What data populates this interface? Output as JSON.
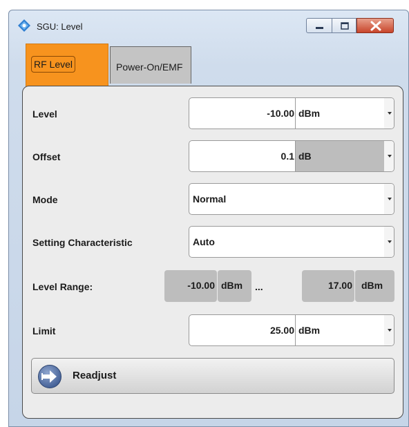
{
  "window": {
    "title": "SGU: Level",
    "controls": {
      "minimize": "minimize",
      "maximize": "maximize",
      "close": "close"
    }
  },
  "tabs": [
    {
      "label": "RF Level",
      "active": true
    },
    {
      "label": "Power-On/EMF",
      "active": false
    }
  ],
  "form": {
    "level": {
      "label": "Level",
      "value": "-10.00",
      "unit": "dBm"
    },
    "offset": {
      "label": "Offset",
      "value": "0.1",
      "unit": "dB"
    },
    "mode": {
      "label": "Mode",
      "value": "Normal"
    },
    "setting_characteristic": {
      "label": "Setting Characteristic",
      "value": "Auto"
    },
    "level_range": {
      "label": "Level Range:",
      "min_value": "-10.00",
      "min_unit": "dBm",
      "separator": "...",
      "max_value": "17.00",
      "max_unit": "dBm"
    },
    "limit": {
      "label": "Limit",
      "value": "25.00",
      "unit": "dBm"
    }
  },
  "readjust": {
    "label": "Readjust"
  },
  "colors": {
    "active_tab": "#f7931e",
    "inactive_tab": "#c4c4c4",
    "panel_bg": "#ececec",
    "readonly_bg": "#bdbdbd",
    "close_button": "#c8452b"
  },
  "icons": {
    "app": "diamond-app-icon",
    "readjust": "arrow-right-circle-icon"
  }
}
